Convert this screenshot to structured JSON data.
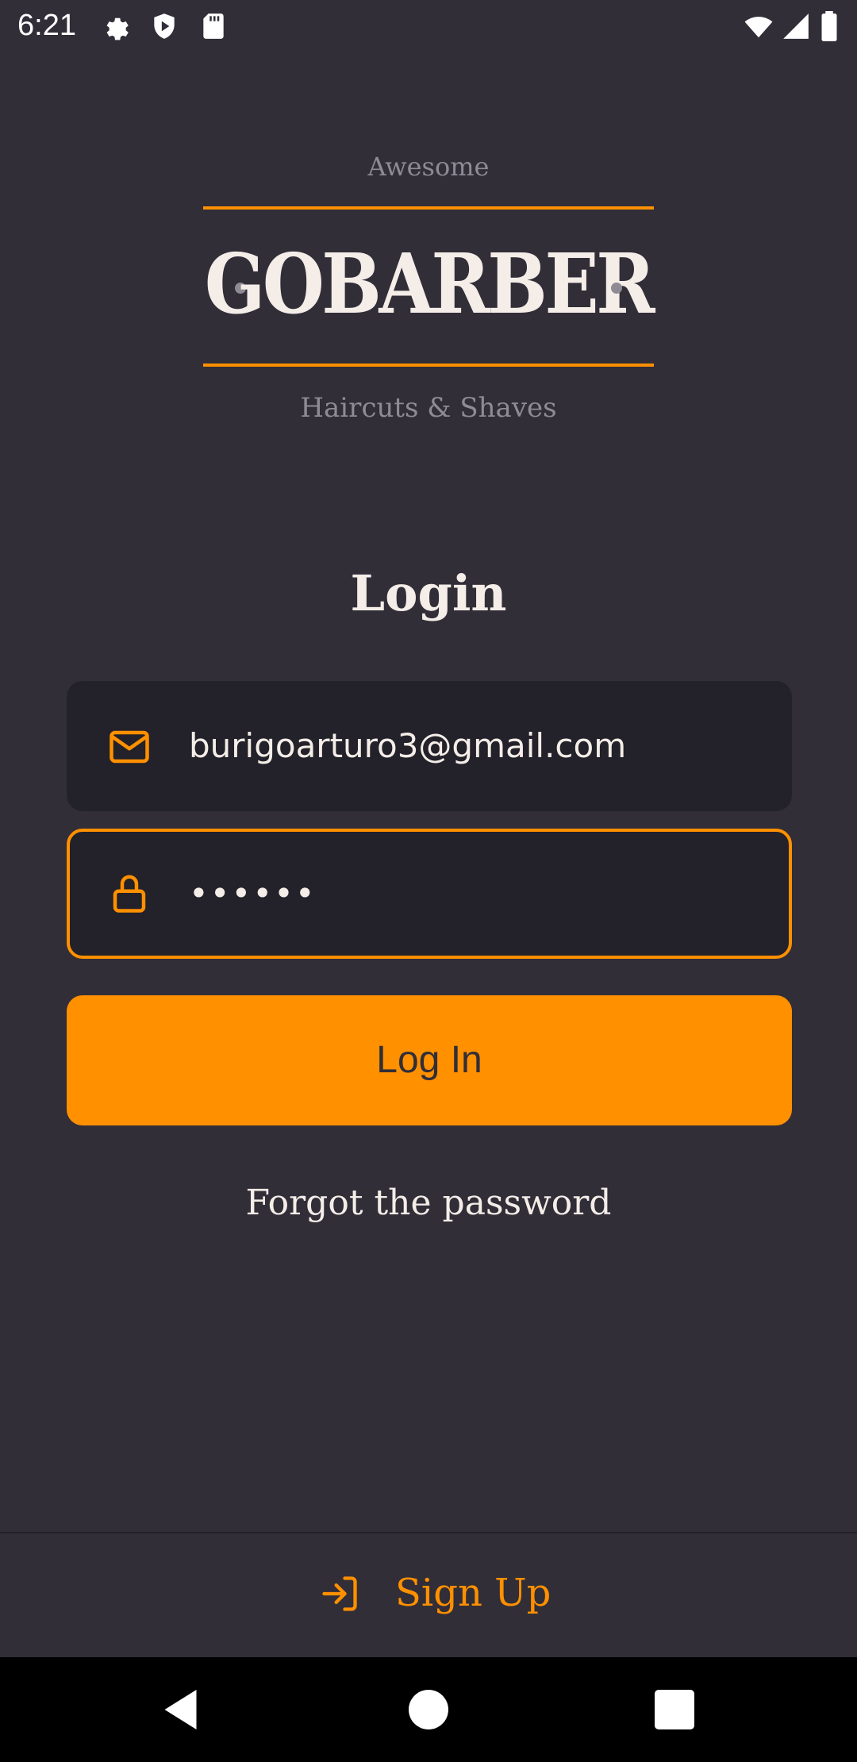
{
  "status_bar": {
    "time": "6:21",
    "icons": [
      "settings-icon",
      "shield-icon",
      "sd-card-icon",
      "wifi-icon",
      "signal-icon",
      "battery-icon"
    ]
  },
  "logo": {
    "top_text": "Awesome",
    "title": "GOBARBER",
    "bottom_text": "Haircuts & Shaves"
  },
  "login": {
    "title": "Login",
    "email_value": "burigoarturo3@gmail.com",
    "password_value": "••••••",
    "button_label": "Log In",
    "forgot_label": "Forgot the password"
  },
  "footer": {
    "signup_label": "Sign Up"
  },
  "colors": {
    "background": "#312e38",
    "input_background": "#232129",
    "accent": "#ff9000",
    "text": "#f4ede8",
    "muted": "#8f8b95"
  },
  "nav_bar": {
    "icons": [
      "back-icon",
      "home-icon",
      "recents-icon"
    ]
  }
}
